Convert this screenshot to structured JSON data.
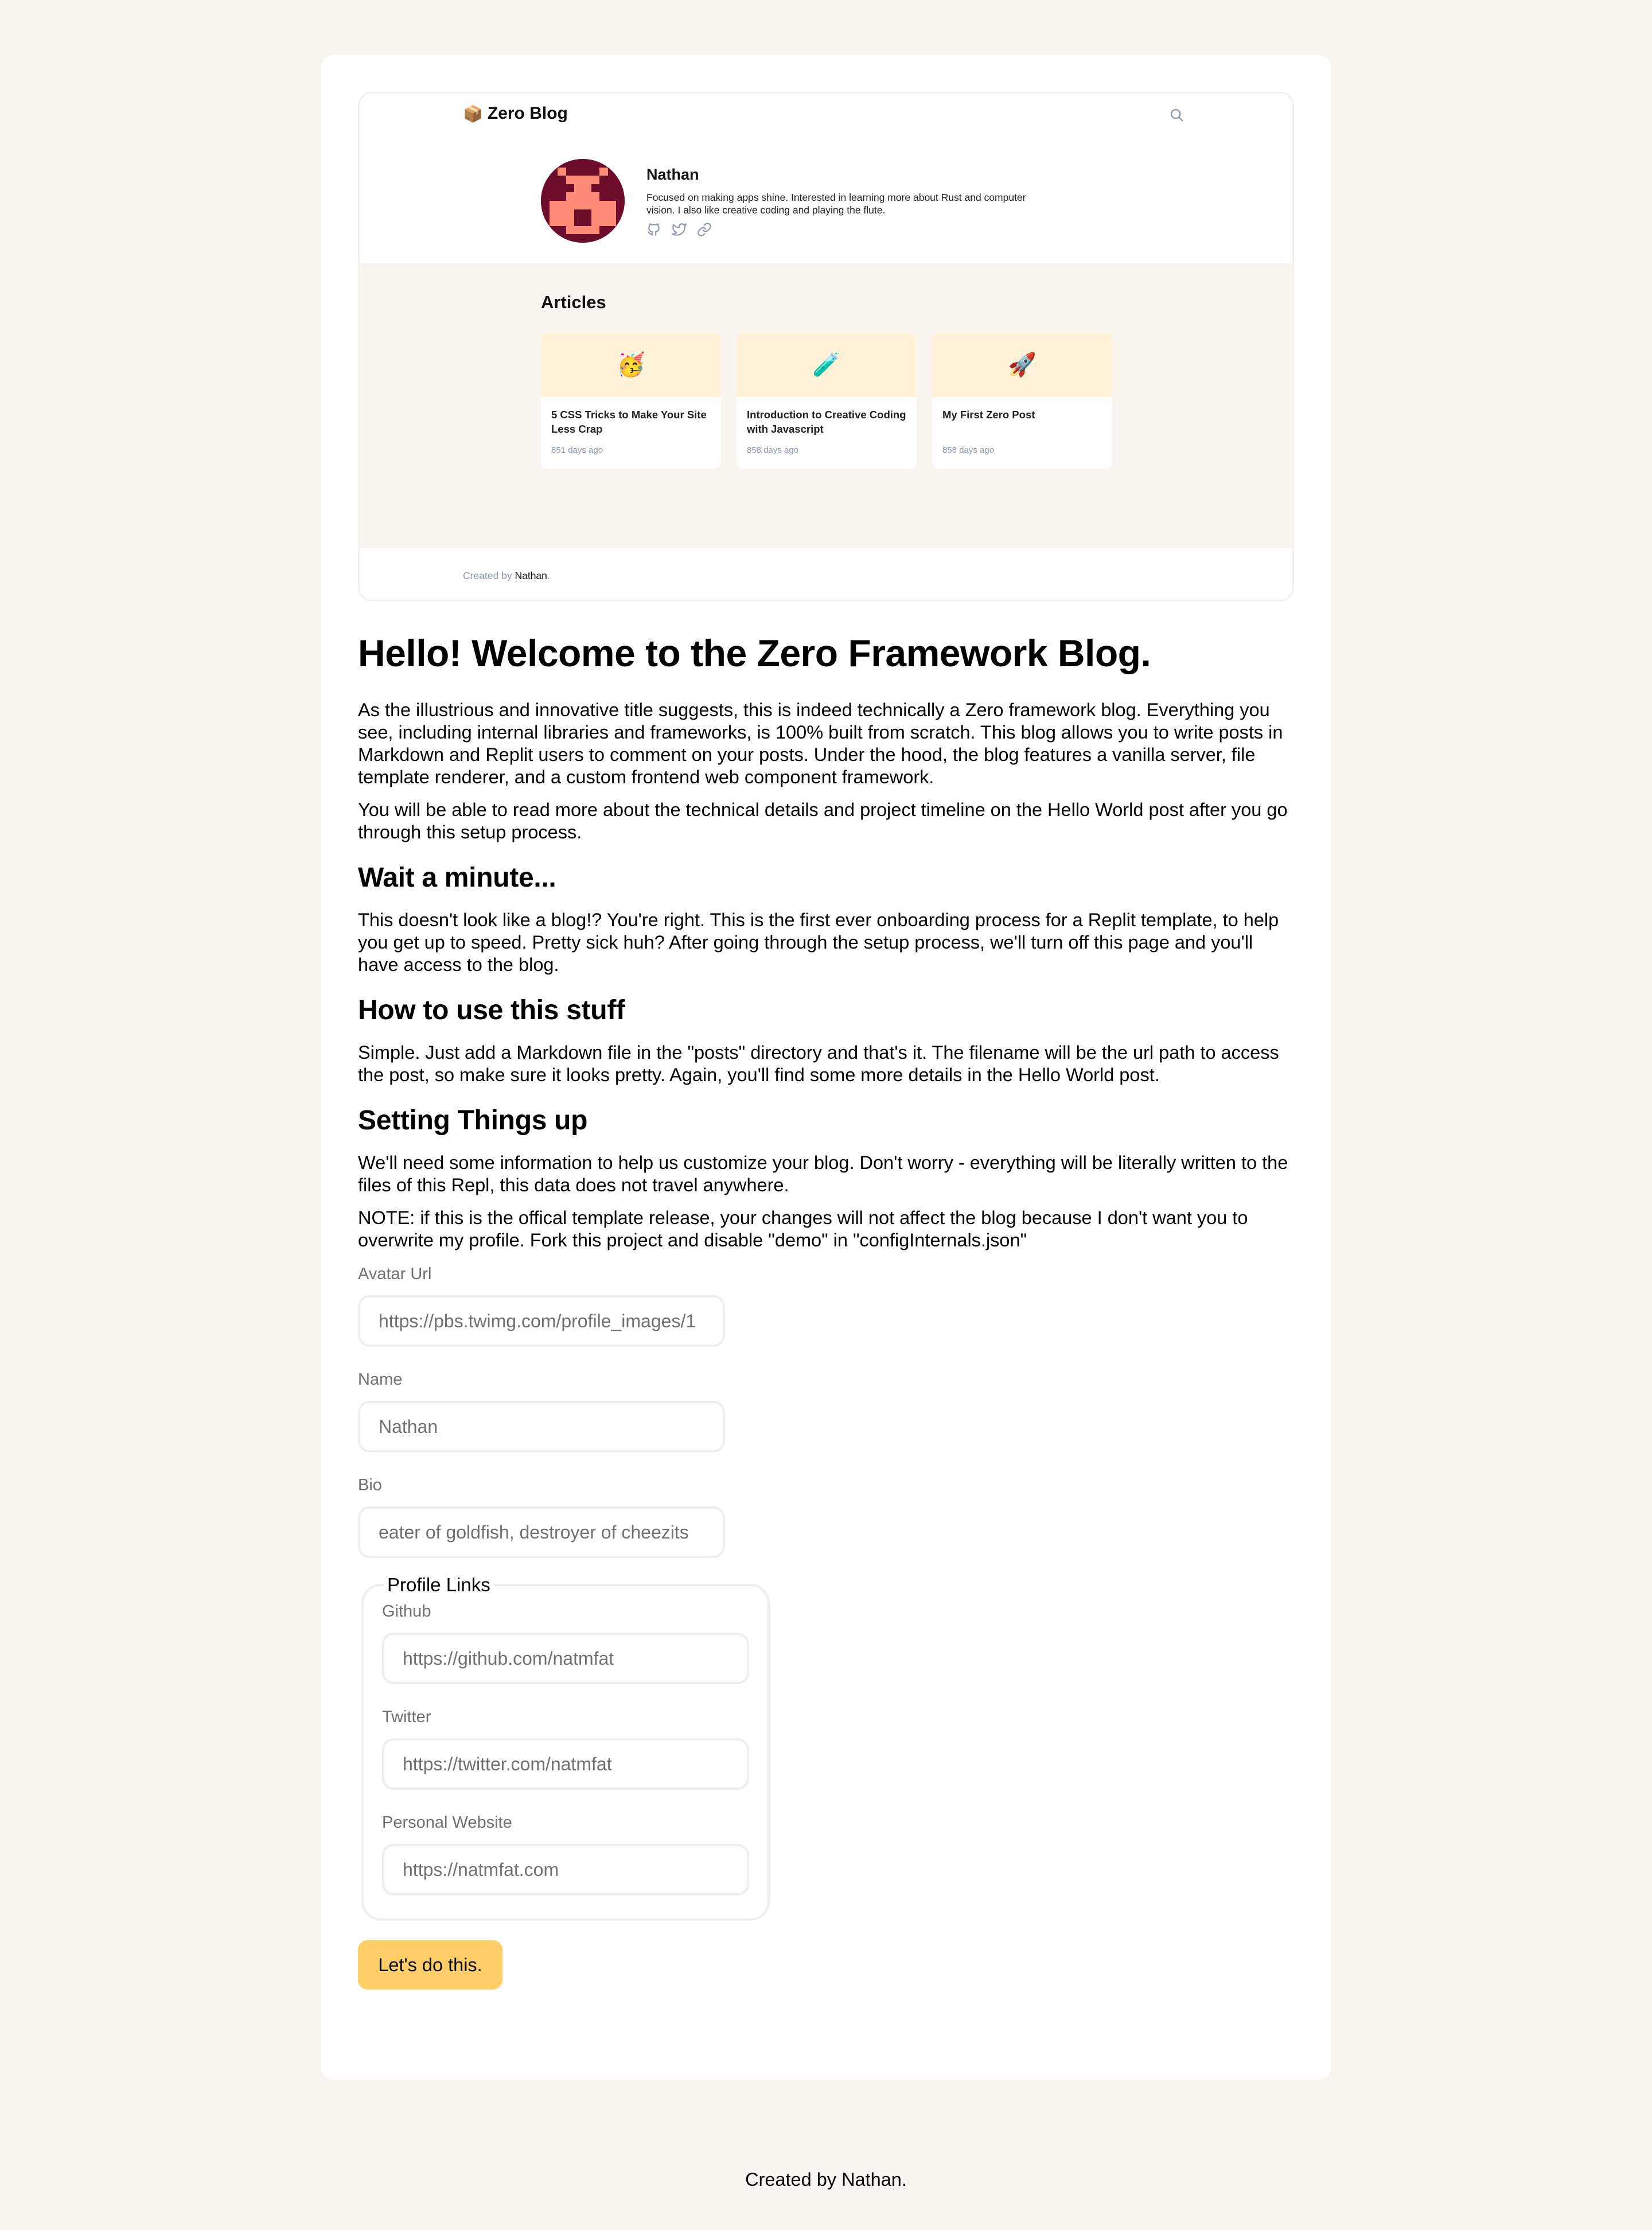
{
  "preview": {
    "logo_emoji": "📦",
    "logo_text": "Zero Blog",
    "search_icon": "search-icon",
    "profile": {
      "name": "Nathan",
      "bio": "Focused on making apps shine. Interested in learning more about Rust and computer vision. I also like creative coding and playing the flute.",
      "avatar_colors": {
        "dark": "#6e0c2b",
        "light": "#fd8b76"
      },
      "links": [
        {
          "icon": "github-icon",
          "label": "Github"
        },
        {
          "icon": "twitter-icon",
          "label": "Twitter"
        },
        {
          "icon": "link-icon",
          "label": "Website"
        }
      ]
    },
    "articles_title": "Articles",
    "articles": [
      {
        "emoji": "🥳",
        "title": "5 CSS Tricks to Make Your Site Less Crap",
        "date": "851 days ago"
      },
      {
        "emoji": "🧪",
        "title": "Introduction to Creative Coding with Javascript",
        "date": "858 days ago"
      },
      {
        "emoji": "🚀",
        "title": "My First Zero Post",
        "date": "858 days ago"
      }
    ],
    "footer": {
      "prefix": "Created by ",
      "author": "Nathan",
      "suffix": "."
    }
  },
  "content": {
    "title": "Hello! Welcome to the Zero Framework Blog.",
    "intro_paragraphs": [
      "As the illustrious and innovative title suggests, this is indeed technically a Zero framework blog. Everything you see, including internal libraries and frameworks, is 100% built from scratch. This blog allows you to write posts in Markdown and Replit users to comment on your posts. Under the hood, the blog features a vanilla server, file template renderer, and a custom frontend web component framework.",
      "You will be able to read more about the technical details and project timeline on the Hello World post after you go through this setup process."
    ],
    "sections": [
      {
        "heading": "Wait a minute...",
        "paragraphs": [
          "This doesn't look like a blog!? You're right. This is the first ever onboarding process for a Replit template, to help you get up to speed. Pretty sick huh? After going through the setup process, we'll turn off this page and you'll have access to the blog."
        ]
      },
      {
        "heading": "How to use this stuff",
        "paragraphs": [
          "Simple. Just add a Markdown file in the \"posts\" directory and that's it. The filename will be the url path to access the post, so make sure it looks pretty. Again, you'll find some more details in the Hello World post."
        ]
      },
      {
        "heading": "Setting Things up",
        "paragraphs": [
          "We'll need some information to help us customize your blog. Don't worry - everything will be literally written to the files of this Repl, this data does not travel anywhere.",
          "NOTE: if this is the offical template release, your changes will not affect the blog because I don't want you to overwrite my profile. Fork this project and disable \"demo\" in \"configInternals.json\""
        ]
      }
    ]
  },
  "form": {
    "avatar": {
      "label": "Avatar Url",
      "placeholder": "https://pbs.twimg.com/profile_images/1"
    },
    "name": {
      "label": "Name",
      "placeholder": "Nathan"
    },
    "bio": {
      "label": "Bio",
      "placeholder": "eater of goldfish, destroyer of cheezits"
    },
    "links_legend": "Profile Links",
    "github": {
      "label": "Github",
      "placeholder": "https://github.com/natmfat"
    },
    "twitter": {
      "label": "Twitter",
      "placeholder": "https://twitter.com/natmfat"
    },
    "website": {
      "label": "Personal Website",
      "placeholder": "https://natmfat.com"
    },
    "submit_label": "Let's do this.",
    "accent_color": "#ffce66"
  },
  "page_footer": "Created by Nathan."
}
